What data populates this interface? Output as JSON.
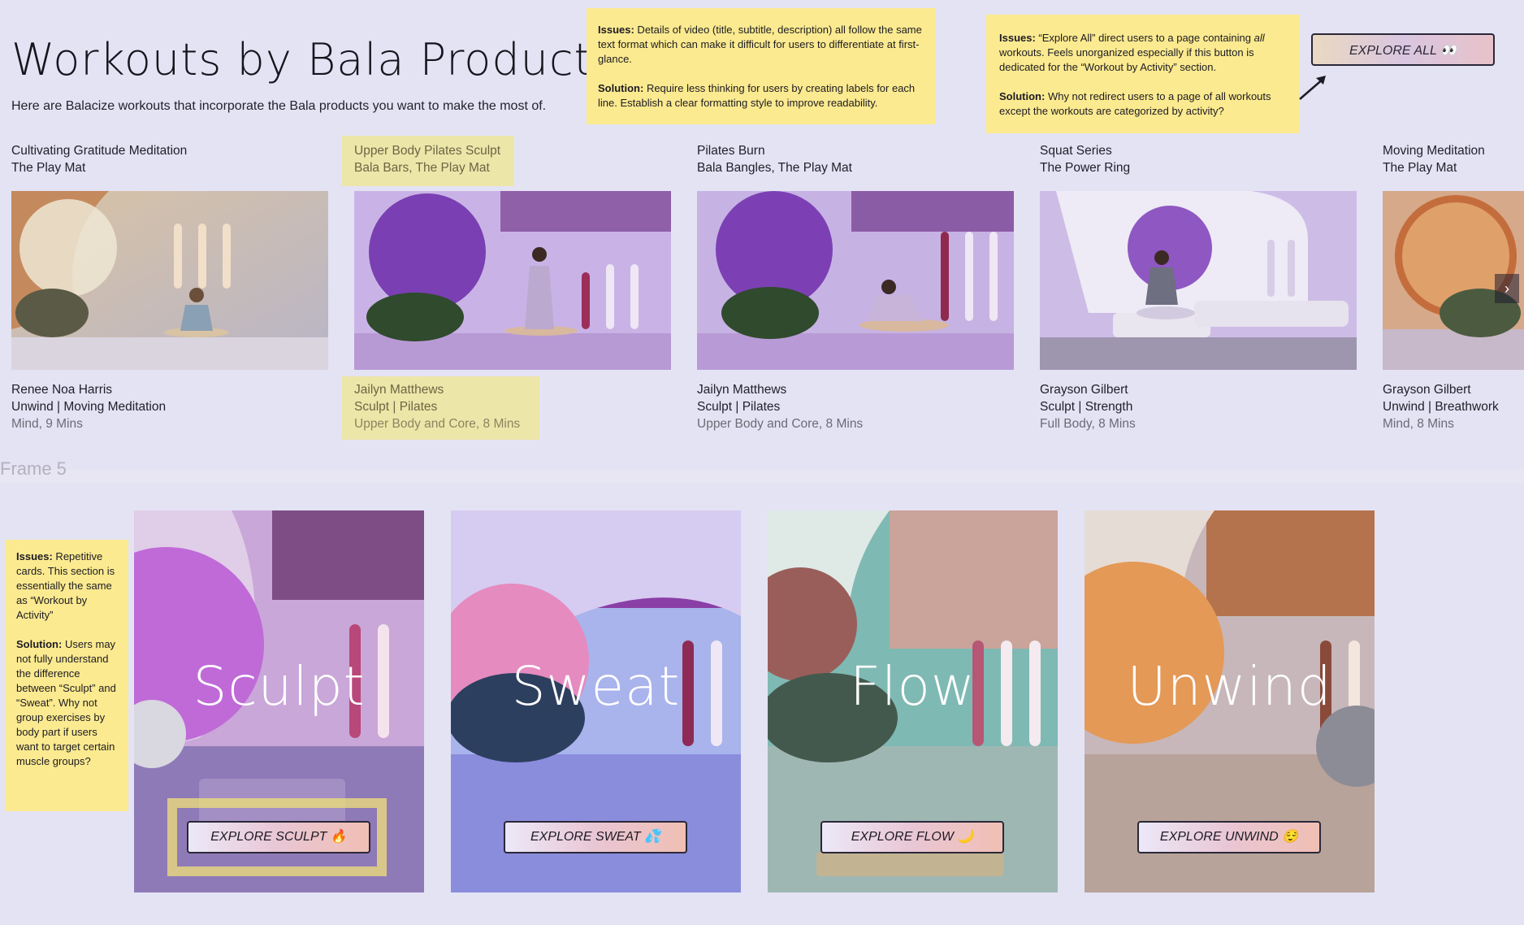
{
  "page": {
    "title": "Workouts by Bala Product",
    "subtitle": "Here are Balacize workouts that incorporate the Bala products you want to make the most of.",
    "explore_all": "EXPLORE ALL 👀",
    "frame_label": "Frame 5",
    "next_arrow": "›"
  },
  "notes": [
    {
      "issue_label": "Issues:",
      "issue": " Details of video (title, subtitle, description) all follow the same text format which can make it difficult for users to differentiate at first-glance.",
      "solution_label": "Solution:",
      "solution": " Require less thinking for users by creating labels for each line. Establish a clear formatting style to improve readability."
    },
    {
      "issue_label": "Issues:",
      "issue_pre": " “Explore All” direct users to a page containing ",
      "issue_em": "all",
      "issue_post": " workouts. Feels unorganized especially if this button is dedicated for the “Workout by Activity” section.",
      "solution_label": "Solution:",
      "solution": " Why not redirect users to a page of all workouts except the workouts are categorized by activity?"
    },
    {
      "issue_label": "Issues:",
      "issue": " Repetitive cards. This section is essentially the same as “Workout by Activity”",
      "solution_label": "Solution:",
      "solution": " Users may not fully understand the difference between “Sculpt” and “Sweat”. Why not group exercises by body part if users want to target certain muscle groups?"
    }
  ],
  "workouts": [
    {
      "title": "Cultivating Gratitude Meditation",
      "products": "The Play Mat",
      "instructor": "Renee Noa Harris",
      "category": "Unwind | Moving Meditation",
      "detail": "Mind, 9 Mins"
    },
    {
      "title": "Upper Body Pilates Sculpt",
      "products": "Bala Bars, The Play Mat",
      "instructor": "Jailyn Matthews",
      "category": "Sculpt | Pilates",
      "detail": "Upper Body and Core, 8 Mins"
    },
    {
      "title": "Pilates Burn",
      "products": "Bala Bangles, The Play Mat",
      "instructor": "Jailyn Matthews",
      "category": "Sculpt | Pilates",
      "detail": "Upper Body and Core, 8 Mins"
    },
    {
      "title": "Squat Series",
      "products": "The Power Ring",
      "instructor": "Grayson Gilbert",
      "category": "Sculpt | Strength",
      "detail": "Full Body, 8 Mins"
    },
    {
      "title": "Moving Meditation",
      "products": "The Play Mat",
      "instructor": "Grayson Gilbert",
      "category": "Unwind | Breathwork",
      "detail": "Mind, 8 Mins"
    }
  ],
  "activities": [
    {
      "name": "Sculpt",
      "button": "EXPLORE SCULPT 🔥"
    },
    {
      "name": "Sweat",
      "button": "EXPLORE SWEAT 💦"
    },
    {
      "name": "Flow",
      "button": "EXPLORE FLOW 🌙"
    },
    {
      "name": "Unwind",
      "button": "EXPLORE UNWIND 😌"
    }
  ],
  "colors": {
    "note": "#fbea8f",
    "highlight": "#ede6a9",
    "background": "#e4e3f4"
  }
}
